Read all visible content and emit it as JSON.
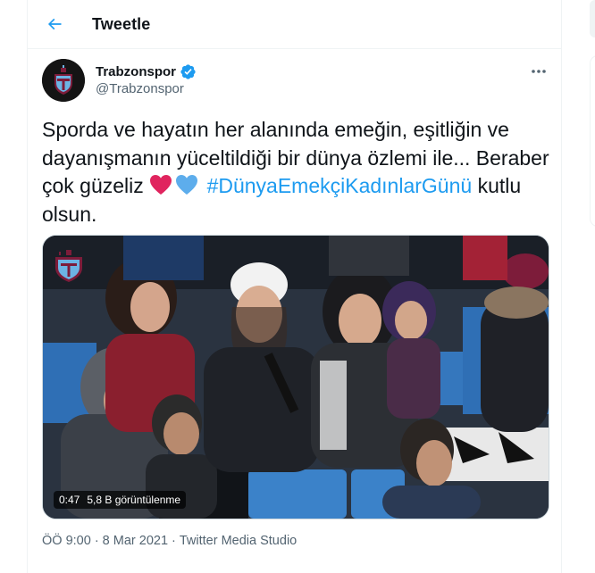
{
  "header": {
    "title": "Tweetle"
  },
  "author": {
    "name": "Trabzonspor",
    "handle": "@Trabzonspor"
  },
  "tweet": {
    "line1": "Sporda ve hayatın her alanında emeğin, eşitliğin ve",
    "line2": "dayanışmanın yüceltildiği bir dünya özlemi ile... Beraber",
    "line3_prefix": "çok güzeliz",
    "hashtag": "#DünyaEmekçiKadınlarGünü",
    "line3_suffix": "kutlu",
    "line4": "olsun.",
    "emoji": [
      "red-heart",
      "blue-heart"
    ]
  },
  "media": {
    "type": "video",
    "duration": "0:47",
    "views": "5,8 B görüntülenme"
  },
  "meta": {
    "time": "ÖÖ 9:00",
    "separator1": "·",
    "date": "8 Mar 2021",
    "separator2": "·",
    "source": "Twitter Media Studio"
  },
  "colors": {
    "accent": "#1d9bf0",
    "text": "#0f1419",
    "secondary": "#536471",
    "heart_red": "#e0245e",
    "heart_blue": "#5dadec",
    "club_maroon": "#7d1c3a",
    "club_blue": "#6cb4e4"
  },
  "icons": {
    "back": "arrow-left-icon",
    "verified": "verified-badge-icon",
    "more": "more-horizontal-icon"
  }
}
